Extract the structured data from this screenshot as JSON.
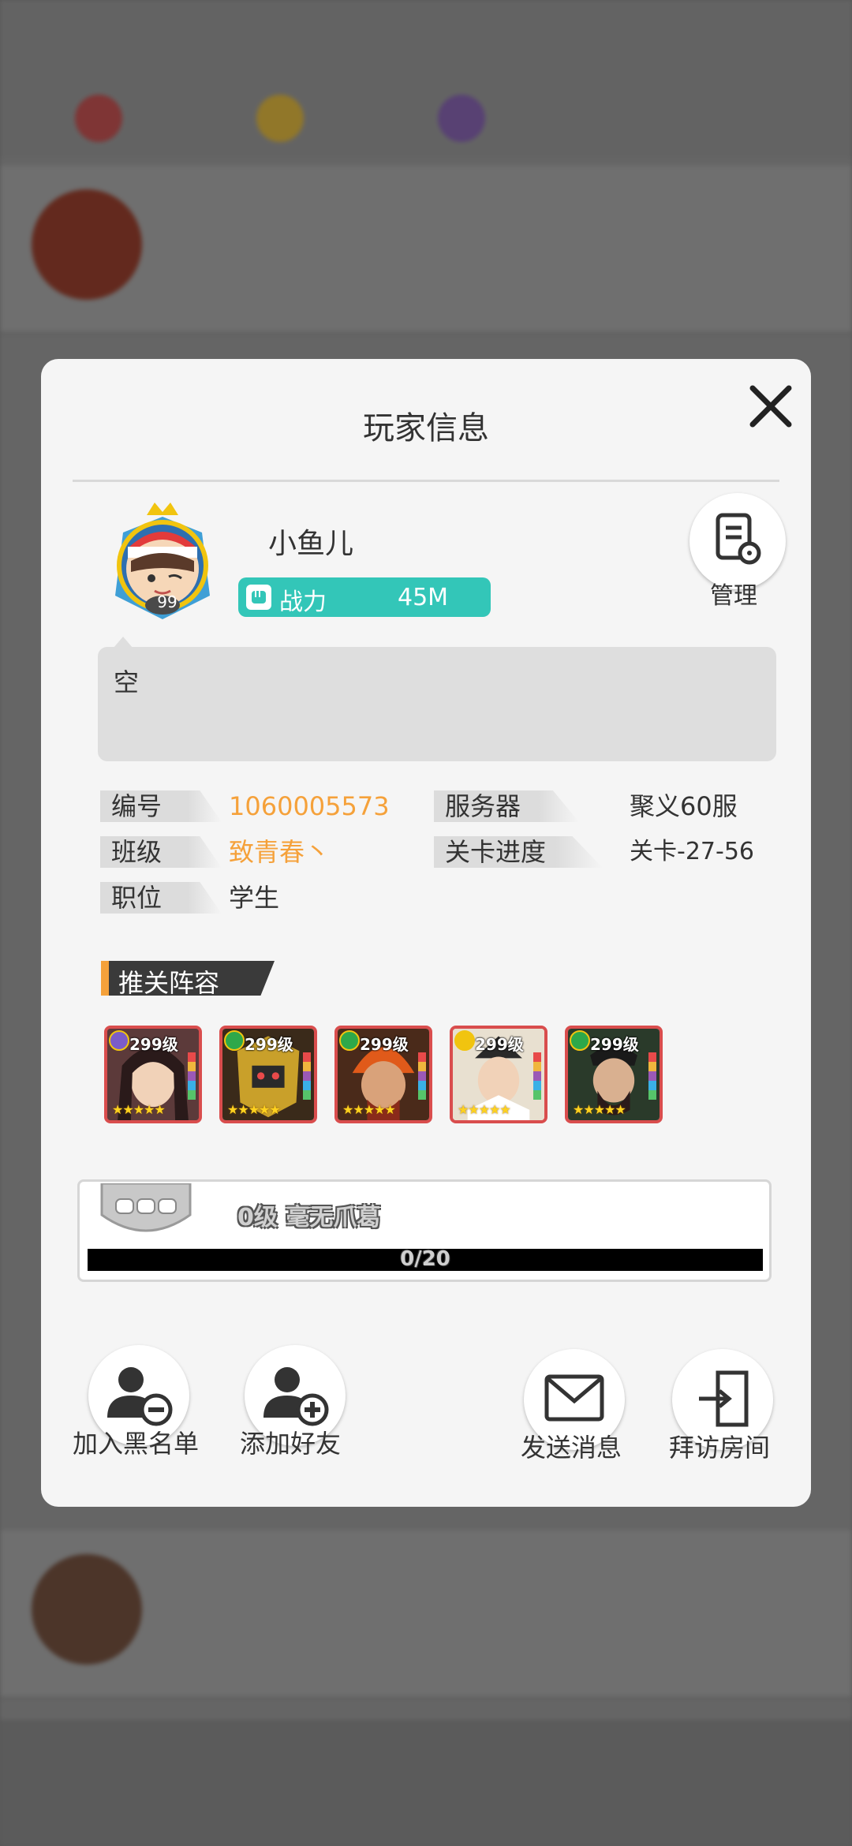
{
  "dialog": {
    "title": "玩家信息",
    "close_icon": "close-icon"
  },
  "player": {
    "name": "小鱼儿",
    "avatar_level": "99",
    "power_label": "战力",
    "power_value": "45M",
    "manage_label": "管理",
    "signature": "空"
  },
  "info": {
    "id_label": "编号",
    "id_value": "1060005573",
    "server_label": "服务器",
    "server_value": "聚义60服",
    "class_label": "班级",
    "class_value": "致青春丶",
    "stage_label": "关卡进度",
    "stage_value": "关卡-27-56",
    "position_label": "职位",
    "position_value": "学生"
  },
  "lineup": {
    "title": "推关阵容",
    "heroes": [
      {
        "level": "299级",
        "badge": "moon-badge-icon",
        "stars": "★★★★★"
      },
      {
        "level": "299级",
        "badge": "spade-badge-icon",
        "stars": "★★★★★"
      },
      {
        "level": "299级",
        "badge": "spade-badge-icon",
        "stars": "★★★★★"
      },
      {
        "level": "299级",
        "badge": "sun-badge-icon",
        "stars": "★★★★★"
      },
      {
        "level": "299级",
        "badge": "spade-badge-icon",
        "stars": "★★★★★"
      }
    ]
  },
  "honor": {
    "title": "0级 毫无爪葛",
    "progress_text": "0/20",
    "progress": 0
  },
  "actions": {
    "blacklist": "加入黑名单",
    "add_friend": "添加好友",
    "send_message": "发送消息",
    "visit_room": "拜访房间"
  },
  "colors": {
    "accent_orange": "#f5a13a",
    "power_teal": "#33c6b8",
    "hero_border": "#d94d4d"
  }
}
